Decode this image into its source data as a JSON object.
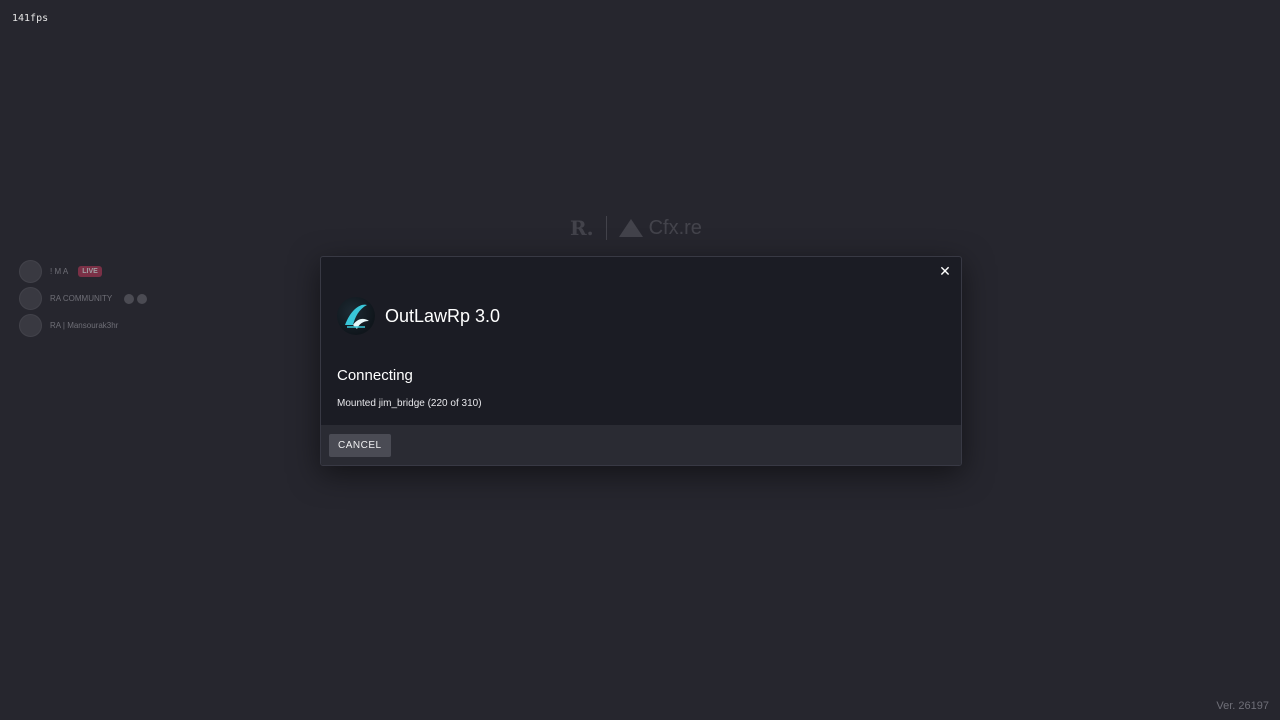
{
  "overlay": {
    "fps": "141fps"
  },
  "footer": {
    "version": "Ver. 26197"
  },
  "background_brand": {
    "cfx_text": "Cfx.re"
  },
  "streams": [
    {
      "name": "! M A",
      "badge": "LIVE"
    },
    {
      "name": "RA COMMUNITY"
    },
    {
      "name": "RA | Mansourak3hr"
    }
  ],
  "modal": {
    "server_name": "OutLawRp 3.0",
    "status_title": "Connecting",
    "status_detail": "Mounted jim_bridge (220 of 310)",
    "progress": {
      "current": 220,
      "total": 310
    },
    "cancel_label": "CANCEL",
    "close_icon": "close-icon"
  }
}
